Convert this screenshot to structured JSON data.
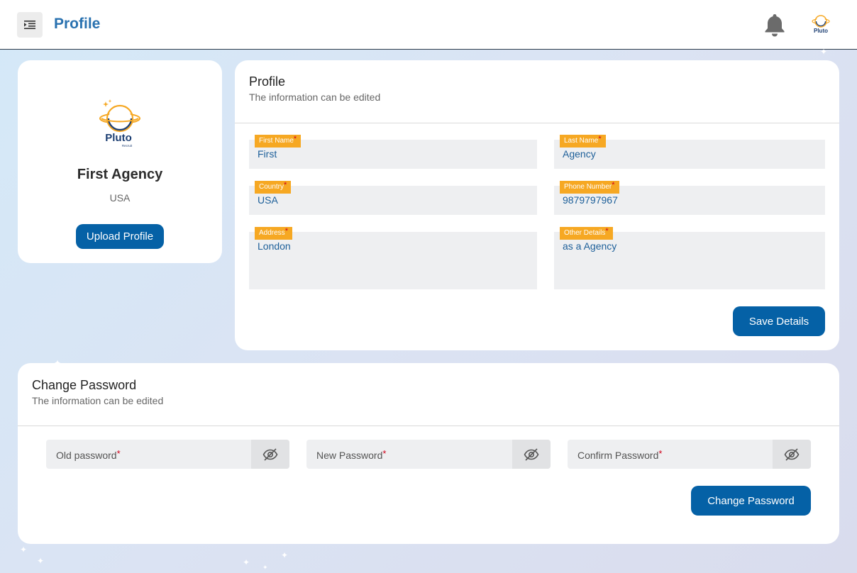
{
  "header": {
    "title": "Profile",
    "menu_icon": "menu-indent-icon",
    "bell_icon": "bell-icon",
    "avatar_icon": "pluto-logo-icon",
    "avatar_text": "Pluto"
  },
  "profile_card": {
    "logo_text": "Pluto",
    "logo_subtext": "Recruit",
    "name": "First Agency",
    "country": "USA",
    "upload_label": "Upload Profile"
  },
  "profile_form": {
    "title": "Profile",
    "subtitle": "The information can be edited",
    "fields": [
      {
        "label": "First Name",
        "value": "First"
      },
      {
        "label": "Last Name",
        "value": "Agency"
      },
      {
        "label": "Country",
        "value": "USA"
      },
      {
        "label": "Phone Number",
        "value": "9879797967"
      },
      {
        "label": "Address",
        "value": "London"
      },
      {
        "label": "Other Details",
        "value": "as a Agency"
      }
    ],
    "required_mark": "*",
    "save_label": "Save Details"
  },
  "password_form": {
    "title": "Change Password",
    "subtitle": "The information can be edited",
    "fields": [
      {
        "placeholder": "Old password"
      },
      {
        "placeholder": "New Password"
      },
      {
        "placeholder": "Confirm Password"
      }
    ],
    "eye_icon": "eye-off-icon",
    "change_label": "Change Password"
  },
  "colors": {
    "brand": "#0561a6",
    "title_blue": "#2a72b0",
    "label_orange": "#f6a823",
    "required_red": "#d0021b"
  }
}
